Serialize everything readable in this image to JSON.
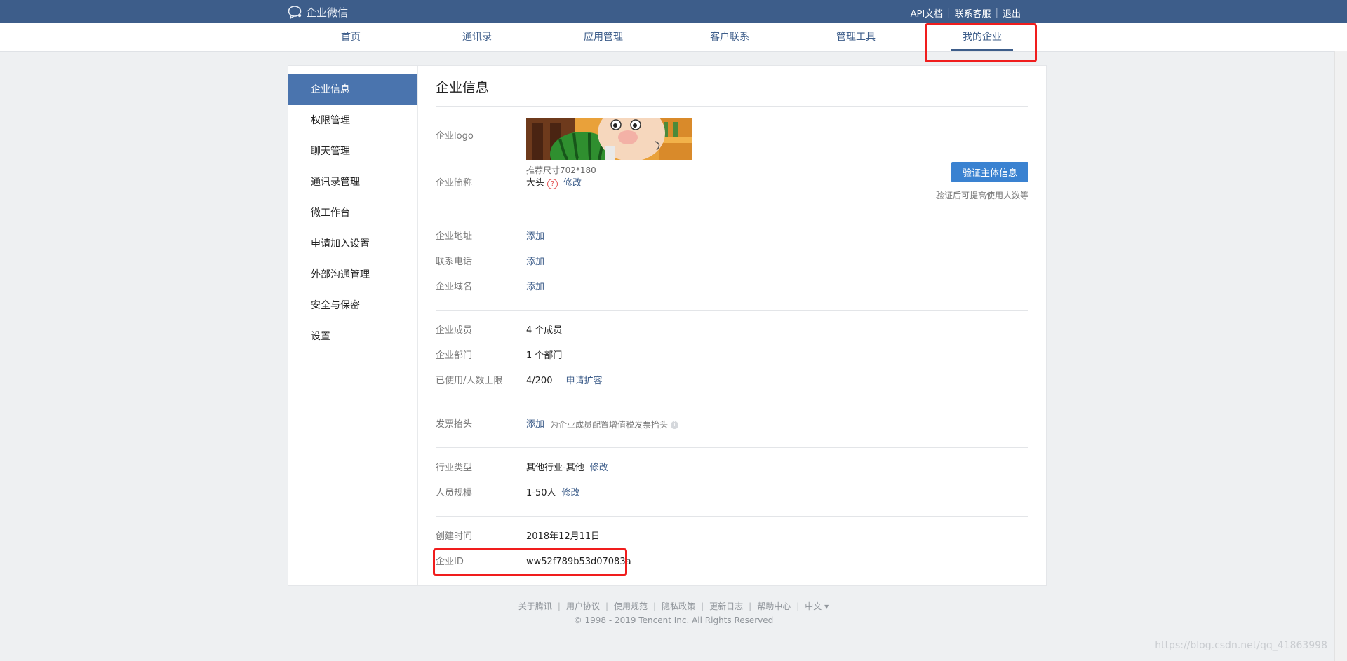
{
  "brand": {
    "name": "企业微信"
  },
  "toplinks": [
    "API文档",
    "联系客服",
    "退出"
  ],
  "nav": {
    "items": [
      "首页",
      "通讯录",
      "应用管理",
      "客户联系",
      "管理工具",
      "我的企业"
    ],
    "active": "我的企业"
  },
  "sidebar": {
    "items": [
      "企业信息",
      "权限管理",
      "聊天管理",
      "通讯录管理",
      "微工作台",
      "申请加入设置",
      "外部沟通管理",
      "安全与保密",
      "设置"
    ],
    "active": "企业信息"
  },
  "main": {
    "title": "企业信息",
    "logo_label": "企业logo",
    "logo_hint": "推荐尺寸702*180",
    "verify_button": "验证主体信息",
    "verify_note": "验证后可提高使用人数等",
    "short_name": {
      "label": "企业简称",
      "value": "大头",
      "action": "修改"
    },
    "address": {
      "label": "企业地址",
      "action": "添加"
    },
    "phone": {
      "label": "联系电话",
      "action": "添加"
    },
    "domain": {
      "label": "企业域名",
      "action": "添加"
    },
    "members": {
      "label": "企业成员",
      "value": "4 个成员"
    },
    "departments": {
      "label": "企业部门",
      "value": "1 个部门"
    },
    "limit": {
      "label": "已使用/人数上限",
      "value": "4/200",
      "action": "申请扩容"
    },
    "invoice": {
      "label": "发票抬头",
      "action": "添加",
      "note": "为企业成员配置增值税发票抬头"
    },
    "industry": {
      "label": "行业类型",
      "value": "其他行业-其他",
      "action": "修改"
    },
    "scale": {
      "label": "人员规模",
      "value": "1-50人",
      "action": "修改"
    },
    "created": {
      "label": "创建时间",
      "value": "2018年12月11日"
    },
    "corp_id": {
      "label": "企业ID",
      "value": "ww52f789b53d07083a"
    }
  },
  "footer": {
    "links": [
      "关于腾讯",
      "用户协议",
      "使用规范",
      "隐私政策",
      "更新日志",
      "帮助中心",
      "中文 ▾"
    ],
    "copyright": "© 1998 - 2019 Tencent Inc. All Rights Reserved"
  },
  "watermark": "https://blog.csdn.net/qq_41863998",
  "colors": {
    "topbar": "#3d5d8a",
    "accent": "#3a82d1",
    "sidebar_active": "#4a74ae",
    "highlight": "#f01d1d"
  }
}
